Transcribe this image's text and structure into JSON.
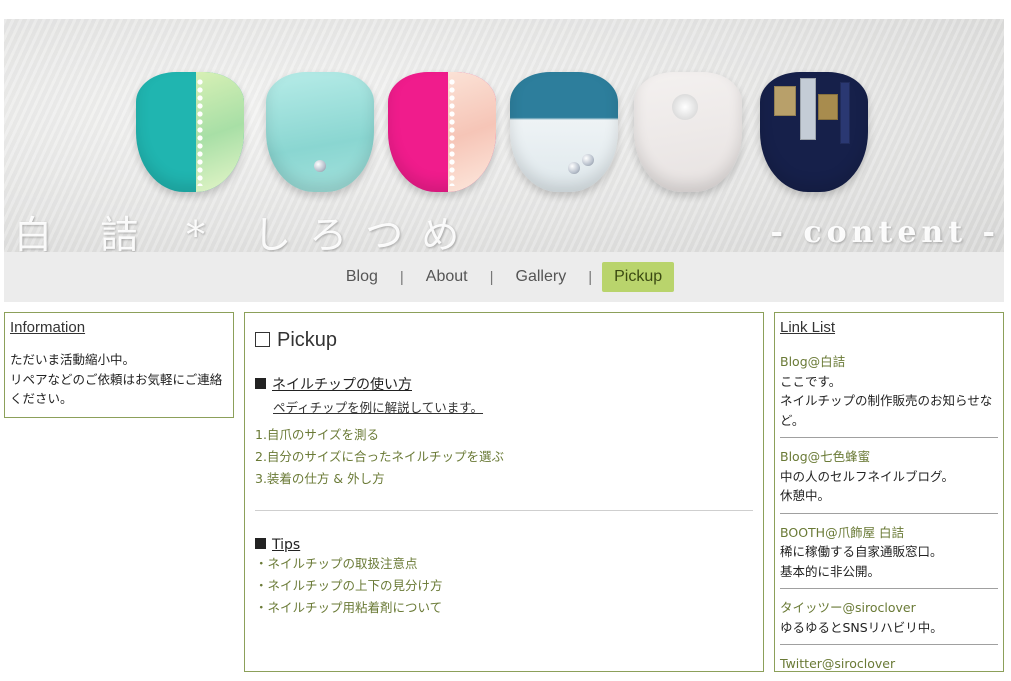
{
  "banner": {
    "site_title": "白 詰 * しろつめ",
    "section_label": "- content -"
  },
  "nav": {
    "items": [
      {
        "label": "Blog"
      },
      {
        "label": "About"
      },
      {
        "label": "Gallery"
      },
      {
        "label": "Pickup"
      }
    ],
    "separator": "|",
    "active": "Pickup",
    "accent_color": "#b9d46c"
  },
  "information": {
    "title": "Information",
    "lines": [
      "ただいま活動縮小中。",
      "リペアなどのご依頼はお気軽にご連絡ください。"
    ]
  },
  "pickup": {
    "heading": "Pickup",
    "sections": [
      {
        "title": "ネイルチップの使い方",
        "subtitle": "ペディチップを例に解説しています。",
        "links": [
          "1.自爪のサイズを測る",
          "2.自分のサイズに合ったネイルチップを選ぶ",
          "3.装着の仕方 & 外し方"
        ]
      },
      {
        "title": "Tips",
        "links": [
          "・ネイルチップの取扱注意点",
          "・ネイルチップの上下の見分け方",
          "・ネイルチップ用粘着剤について"
        ]
      }
    ]
  },
  "link_list": {
    "title": "Link List",
    "items": [
      {
        "name": "Blog@白詰",
        "desc": [
          "ここです。",
          "ネイルチップの制作販売のお知らせなど。"
        ]
      },
      {
        "name": "Blog@七色蜂蜜",
        "desc": [
          "中の人のセルフネイルブログ。",
          "休憩中。"
        ]
      },
      {
        "name": "BOOTH@爪飾屋 白詰",
        "desc": [
          "稀に稼働する自家通販窓口。",
          "基本的に非公開。"
        ]
      },
      {
        "name": "タイッツー@siroclover",
        "desc": [
          "ゆるゆるとSNSリハビリ中。"
        ]
      },
      {
        "name": "Twitter@siroclover",
        "desc": []
      }
    ]
  },
  "colors": {
    "link_green": "#6a7a36",
    "box_border": "#8ca05a",
    "nav_bg": "#ececec"
  }
}
